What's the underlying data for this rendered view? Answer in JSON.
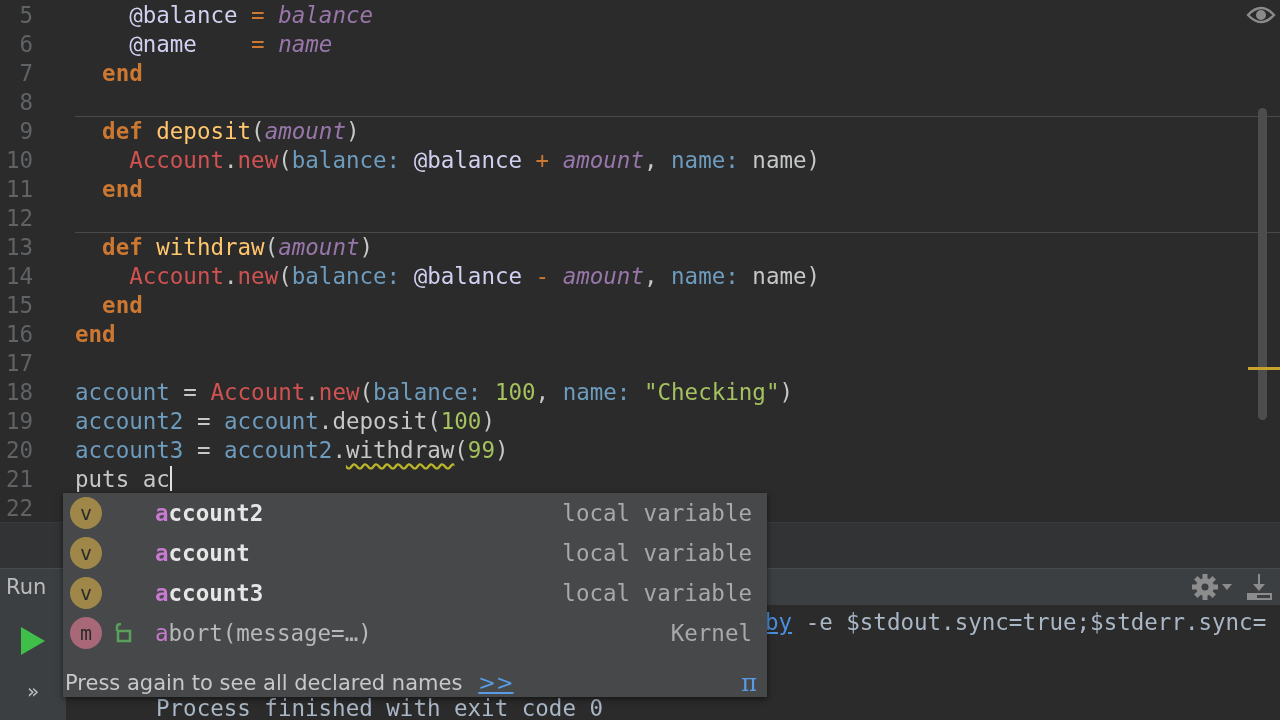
{
  "editor": {
    "lines": [
      {
        "number": "5",
        "separator": false,
        "cursor": false,
        "code": [
          {
            "kind": "ivar",
            "text": "    @balance"
          },
          {
            "kind": "op",
            "text": " = "
          },
          {
            "kind": "param",
            "text": "balance"
          }
        ]
      },
      {
        "number": "6",
        "separator": false,
        "cursor": false,
        "code": [
          {
            "kind": "ivar",
            "text": "    @name"
          },
          {
            "kind": "op",
            "text": "    = "
          },
          {
            "kind": "param",
            "text": "name"
          }
        ]
      },
      {
        "number": "7",
        "separator": false,
        "cursor": false,
        "code": [
          {
            "kind": "keyword",
            "text": "  end"
          }
        ]
      },
      {
        "number": "8",
        "separator": false,
        "cursor": false
      },
      {
        "number": "9",
        "separator": true,
        "cursor": false,
        "code": [
          {
            "kind": "keyword",
            "text": "  def"
          },
          {
            "kind": "def",
            "text": " deposit"
          },
          {
            "kind": "plain",
            "text": "("
          },
          {
            "kind": "param",
            "text": "amount"
          },
          {
            "kind": "plain",
            "text": ")"
          }
        ]
      },
      {
        "number": "10",
        "separator": false,
        "cursor": false,
        "code": [
          {
            "kind": "const",
            "text": "    Account"
          },
          {
            "kind": "plain",
            "text": "."
          },
          {
            "kind": "const",
            "text": "new"
          },
          {
            "kind": "plain",
            "text": "("
          },
          {
            "kind": "label",
            "text": "balance:"
          },
          {
            "kind": "ivar",
            "text": " @balance"
          },
          {
            "kind": "op",
            "text": " + "
          },
          {
            "kind": "param",
            "text": "amount"
          },
          {
            "kind": "plain",
            "text": ", "
          },
          {
            "kind": "label",
            "text": "name:"
          },
          {
            "kind": "plain",
            "text": " name)"
          }
        ]
      },
      {
        "number": "11",
        "separator": false,
        "cursor": false,
        "code": [
          {
            "kind": "keyword",
            "text": "  end"
          }
        ]
      },
      {
        "number": "12",
        "separator": false,
        "cursor": false
      },
      {
        "number": "13",
        "separator": true,
        "cursor": false,
        "code": [
          {
            "kind": "keyword",
            "text": "  def"
          },
          {
            "kind": "def",
            "text": " withdraw"
          },
          {
            "kind": "plain",
            "text": "("
          },
          {
            "kind": "param",
            "text": "amount"
          },
          {
            "kind": "plain",
            "text": ")"
          }
        ]
      },
      {
        "number": "14",
        "separator": false,
        "cursor": false,
        "code": [
          {
            "kind": "const",
            "text": "    Account"
          },
          {
            "kind": "plain",
            "text": "."
          },
          {
            "kind": "const",
            "text": "new"
          },
          {
            "kind": "plain",
            "text": "("
          },
          {
            "kind": "label",
            "text": "balance:"
          },
          {
            "kind": "ivar",
            "text": " @balance"
          },
          {
            "kind": "op",
            "text": " - "
          },
          {
            "kind": "param",
            "text": "amount"
          },
          {
            "kind": "plain",
            "text": ", "
          },
          {
            "kind": "label",
            "text": "name:"
          },
          {
            "kind": "plain",
            "text": " name)"
          }
        ]
      },
      {
        "number": "15",
        "separator": false,
        "cursor": false,
        "code": [
          {
            "kind": "keyword",
            "text": "  end"
          }
        ]
      },
      {
        "number": "16",
        "separator": false,
        "cursor": false,
        "code": [
          {
            "kind": "keyword",
            "text": "end"
          }
        ]
      },
      {
        "number": "17",
        "separator": false,
        "cursor": false
      },
      {
        "number": "18",
        "separator": false,
        "cursor": false,
        "code": [
          {
            "kind": "var",
            "text": "account"
          },
          {
            "kind": "plain",
            "text": " = "
          },
          {
            "kind": "const",
            "text": "Account"
          },
          {
            "kind": "plain",
            "text": "."
          },
          {
            "kind": "const",
            "text": "new"
          },
          {
            "kind": "plain",
            "text": "("
          },
          {
            "kind": "label",
            "text": "balance:"
          },
          {
            "kind": "number",
            "text": " 100"
          },
          {
            "kind": "plain",
            "text": ", "
          },
          {
            "kind": "label",
            "text": "name:"
          },
          {
            "kind": "string",
            "text": " \"Checking\""
          },
          {
            "kind": "plain",
            "text": ")"
          }
        ]
      },
      {
        "number": "19",
        "separator": false,
        "cursor": false,
        "code": [
          {
            "kind": "var",
            "text": "account2"
          },
          {
            "kind": "plain",
            "text": " = "
          },
          {
            "kind": "var",
            "text": "account"
          },
          {
            "kind": "plain",
            "text": ".deposit("
          },
          {
            "kind": "number",
            "text": "100"
          },
          {
            "kind": "plain",
            "text": ")"
          }
        ]
      },
      {
        "number": "20",
        "separator": false,
        "cursor": false,
        "code": [
          {
            "kind": "var",
            "text": "account3"
          },
          {
            "kind": "plain",
            "text": " = "
          },
          {
            "kind": "var",
            "text": "account2"
          },
          {
            "kind": "plain",
            "text": "."
          },
          {
            "kind": "warning",
            "text": "withdraw"
          },
          {
            "kind": "plain",
            "text": "("
          },
          {
            "kind": "number",
            "text": "99"
          },
          {
            "kind": "plain",
            "text": ")"
          }
        ]
      },
      {
        "number": "21",
        "separator": false,
        "cursor": true,
        "code": [
          {
            "kind": "plain",
            "text": "puts ac"
          }
        ]
      },
      {
        "number": "22",
        "separator": false,
        "cursor": false
      }
    ]
  },
  "run_panel": {
    "title": "Run",
    "more": "»",
    "console": [
      {
        "link": "by",
        "text": " -e $stdout.sync=true;$stderr.sync="
      },
      {
        "text": "Process finished with exit code 0"
      }
    ]
  },
  "completion": {
    "items": [
      {
        "kind": "variable",
        "badge": "v",
        "color": "#9e8748",
        "match": "a",
        "rest": "ccount2",
        "type": "local variable"
      },
      {
        "kind": "variable",
        "badge": "v",
        "color": "#9e8748",
        "match": "a",
        "rest": "ccount",
        "type": "local variable"
      },
      {
        "kind": "variable",
        "badge": "v",
        "color": "#9e8748",
        "match": "a",
        "rest": "ccount3",
        "type": "local variable"
      },
      {
        "kind": "method",
        "badge": "m",
        "color": "#a86878",
        "match": "a",
        "rest": "bort(message=…)",
        "type": "Kernel"
      }
    ],
    "hint": "Press again to see all declared names",
    "hint_link": ">>",
    "corner": "π"
  }
}
